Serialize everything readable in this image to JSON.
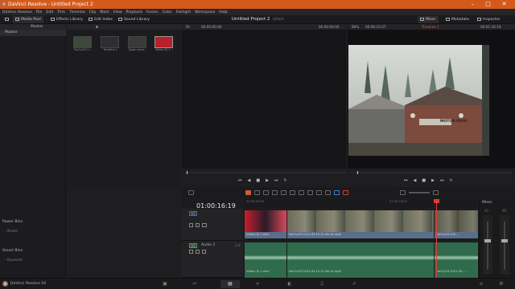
{
  "titlebar": {
    "title": "DaVinci Resolve - Untitled Project 2",
    "minimize": "–",
    "maximize": "□",
    "close": "✕"
  },
  "menu": [
    "DaVinci Resolve",
    "File",
    "Edit",
    "Trim",
    "Timeline",
    "Clip",
    "Mark",
    "View",
    "Playback",
    "Fusion",
    "Color",
    "Fairlight",
    "Workspace",
    "Help"
  ],
  "toolbar": {
    "media_pool": "Media Pool",
    "effects_library": "Effects Library",
    "edit_index": "Edit Index",
    "sound_library": "Sound Library",
    "project_title": "Untitled Project 2",
    "project_status": "Edited",
    "mixer": "Mixer",
    "metadata": "Metadata",
    "inspector": "Inspector"
  },
  "bins": {
    "header": "Master",
    "master": "Master",
    "power_bins": "Power Bins",
    "power_master": "Master",
    "smart_bins": "Smart Bins",
    "keywords": "Keywords"
  },
  "media_pool": {
    "clips": [
      {
        "label": "FarCry93 2...",
        "color": "#3d4a3a"
      },
      {
        "label": "Timeline 1",
        "color": "#2e2e30"
      },
      {
        "label": "Zoom recor...",
        "color": "#3a3a3c"
      },
      {
        "label": "Video (5) 1...",
        "color": "#b8202a"
      }
    ]
  },
  "source_viewer": {
    "zoom": "Fit",
    "timecode_left": "00:00:00:00",
    "timecode_right": "00:00:00:00"
  },
  "timeline_viewer": {
    "zoom": "86%",
    "timecode_left": "00:00:15:07",
    "timeline_name": "Timeline 1",
    "timecode_right": "00:01:16:19",
    "sign_text": "MOTOR POOL"
  },
  "timeline": {
    "timecode": "01:00:16:19",
    "ruler": [
      "01:00:00:00",
      "01:00:16:00"
    ],
    "video_track": {
      "name": "V1",
      "clips": [
        {
          "label": "Video (5) 1.mkv"
        },
        {
          "label": "FarCry93 2021-05-10 21-06-16.mp4"
        },
        {
          "label": "FarCry93 202..."
        }
      ]
    },
    "audio_track": {
      "name": "Audio 1",
      "id": "A1",
      "level": "2.0",
      "clips": [
        {
          "label": "Video (5) 1.mkv"
        },
        {
          "label": "FarCry93 2021-05-10 21-06-14.mp4"
        },
        {
          "label": "FarCry93 2021-05-..."
        }
      ]
    }
  },
  "mixer": {
    "title": "Mixer",
    "channels": [
      "A1",
      "M1"
    ]
  },
  "bottom": {
    "app_name": "DaVinci Resolve 16"
  },
  "colors": {
    "accent": "#d45a1c",
    "video_clip": "#5a6e8a",
    "audio_clip": "#2f6b4c",
    "playhead": "#e03a3a"
  }
}
